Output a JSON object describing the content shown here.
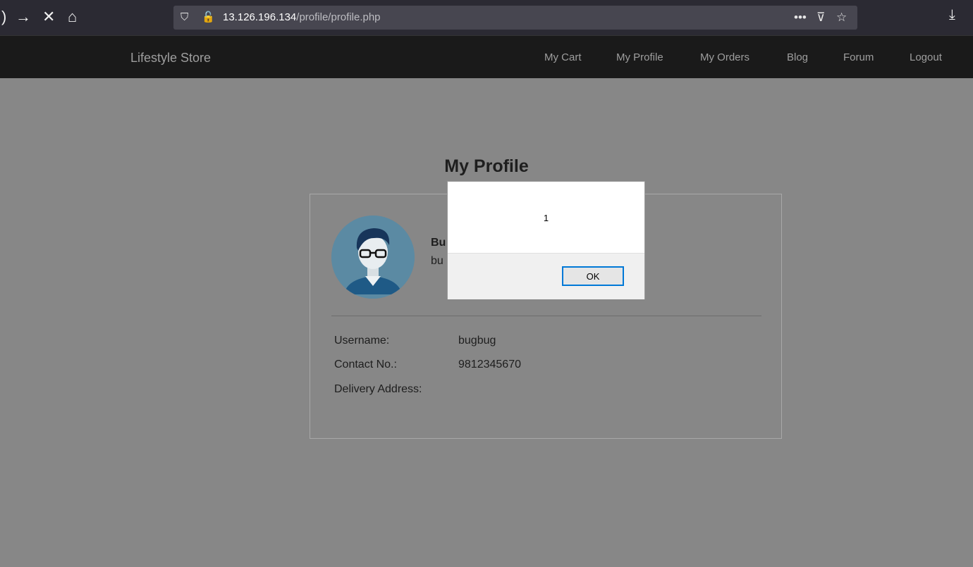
{
  "browser": {
    "url_host": "13.126.196.134",
    "url_path": "/profile/profile.php"
  },
  "site": {
    "brand": "Lifestyle Store",
    "nav": [
      "My Cart",
      "My Profile",
      "My Orders",
      "Blog",
      "Forum",
      "Logout"
    ]
  },
  "profile": {
    "title": "My Profile",
    "name_partial": "Bu",
    "email_partial": "bu",
    "fields": [
      {
        "label": "Username:",
        "value": "bugbug"
      },
      {
        "label": "Contact No.:",
        "value": "9812345670"
      },
      {
        "label": "Delivery Address:",
        "value": ""
      }
    ]
  },
  "alert": {
    "message": "1",
    "ok_label": "OK"
  },
  "colors": {
    "overlay": "#878787",
    "navbar": "#1a1a1a",
    "browser_chrome": "#2b2a33",
    "ok_border": "#0078d7"
  }
}
